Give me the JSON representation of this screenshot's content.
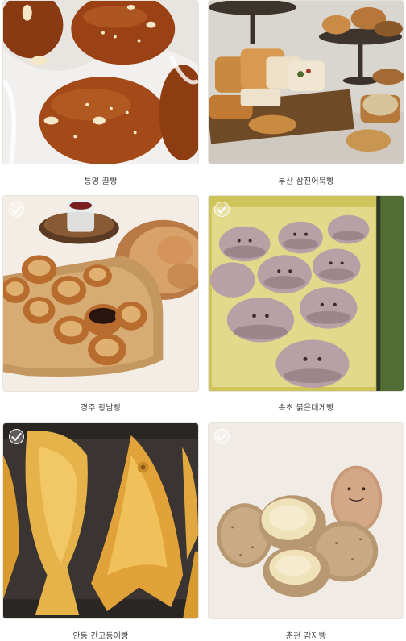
{
  "products": [
    {
      "name": "통영 꿀빵",
      "image_icon": "honey-bread-photo"
    },
    {
      "name": "부산 삼진어묵빵",
      "image_icon": "fishcake-bread-photo"
    },
    {
      "name": "경주 황남빵",
      "image_icon": "hwangnam-bread-photo",
      "check_icon": "check-circle-icon"
    },
    {
      "name": "속초 붉은대게빵",
      "image_icon": "red-crab-bread-photo",
      "check_icon": "check-circle-icon"
    },
    {
      "name": "안동 간고등어빵",
      "image_icon": "mackerel-bread-photo",
      "check_icon": "check-circle-icon"
    },
    {
      "name": "춘천 감자빵",
      "image_icon": "potato-bread-photo",
      "check_icon": "check-circle-icon"
    }
  ]
}
